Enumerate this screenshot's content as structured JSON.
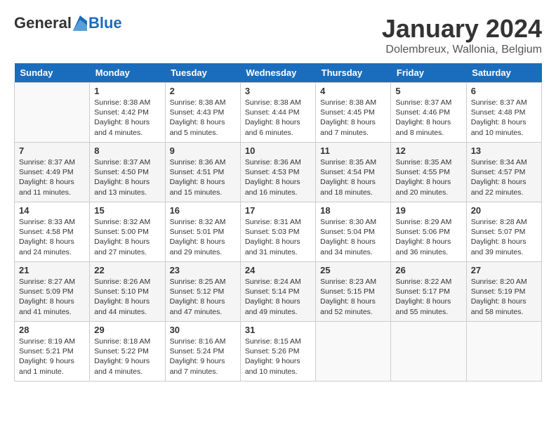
{
  "logo": {
    "general": "General",
    "blue": "Blue"
  },
  "title": "January 2024",
  "location": "Dolembreux, Wallonia, Belgium",
  "days_of_week": [
    "Sunday",
    "Monday",
    "Tuesday",
    "Wednesday",
    "Thursday",
    "Friday",
    "Saturday"
  ],
  "weeks": [
    [
      {
        "day": "",
        "sunrise": "",
        "sunset": "",
        "daylight": "",
        "empty": true
      },
      {
        "day": "1",
        "sunrise": "Sunrise: 8:38 AM",
        "sunset": "Sunset: 4:42 PM",
        "daylight": "Daylight: 8 hours and 4 minutes."
      },
      {
        "day": "2",
        "sunrise": "Sunrise: 8:38 AM",
        "sunset": "Sunset: 4:43 PM",
        "daylight": "Daylight: 8 hours and 5 minutes."
      },
      {
        "day": "3",
        "sunrise": "Sunrise: 8:38 AM",
        "sunset": "Sunset: 4:44 PM",
        "daylight": "Daylight: 8 hours and 6 minutes."
      },
      {
        "day": "4",
        "sunrise": "Sunrise: 8:38 AM",
        "sunset": "Sunset: 4:45 PM",
        "daylight": "Daylight: 8 hours and 7 minutes."
      },
      {
        "day": "5",
        "sunrise": "Sunrise: 8:37 AM",
        "sunset": "Sunset: 4:46 PM",
        "daylight": "Daylight: 8 hours and 8 minutes."
      },
      {
        "day": "6",
        "sunrise": "Sunrise: 8:37 AM",
        "sunset": "Sunset: 4:48 PM",
        "daylight": "Daylight: 8 hours and 10 minutes."
      }
    ],
    [
      {
        "day": "7",
        "sunrise": "Sunrise: 8:37 AM",
        "sunset": "Sunset: 4:49 PM",
        "daylight": "Daylight: 8 hours and 11 minutes."
      },
      {
        "day": "8",
        "sunrise": "Sunrise: 8:37 AM",
        "sunset": "Sunset: 4:50 PM",
        "daylight": "Daylight: 8 hours and 13 minutes."
      },
      {
        "day": "9",
        "sunrise": "Sunrise: 8:36 AM",
        "sunset": "Sunset: 4:51 PM",
        "daylight": "Daylight: 8 hours and 15 minutes."
      },
      {
        "day": "10",
        "sunrise": "Sunrise: 8:36 AM",
        "sunset": "Sunset: 4:53 PM",
        "daylight": "Daylight: 8 hours and 16 minutes."
      },
      {
        "day": "11",
        "sunrise": "Sunrise: 8:35 AM",
        "sunset": "Sunset: 4:54 PM",
        "daylight": "Daylight: 8 hours and 18 minutes."
      },
      {
        "day": "12",
        "sunrise": "Sunrise: 8:35 AM",
        "sunset": "Sunset: 4:55 PM",
        "daylight": "Daylight: 8 hours and 20 minutes."
      },
      {
        "day": "13",
        "sunrise": "Sunrise: 8:34 AM",
        "sunset": "Sunset: 4:57 PM",
        "daylight": "Daylight: 8 hours and 22 minutes."
      }
    ],
    [
      {
        "day": "14",
        "sunrise": "Sunrise: 8:33 AM",
        "sunset": "Sunset: 4:58 PM",
        "daylight": "Daylight: 8 hours and 24 minutes."
      },
      {
        "day": "15",
        "sunrise": "Sunrise: 8:32 AM",
        "sunset": "Sunset: 5:00 PM",
        "daylight": "Daylight: 8 hours and 27 minutes."
      },
      {
        "day": "16",
        "sunrise": "Sunrise: 8:32 AM",
        "sunset": "Sunset: 5:01 PM",
        "daylight": "Daylight: 8 hours and 29 minutes."
      },
      {
        "day": "17",
        "sunrise": "Sunrise: 8:31 AM",
        "sunset": "Sunset: 5:03 PM",
        "daylight": "Daylight: 8 hours and 31 minutes."
      },
      {
        "day": "18",
        "sunrise": "Sunrise: 8:30 AM",
        "sunset": "Sunset: 5:04 PM",
        "daylight": "Daylight: 8 hours and 34 minutes."
      },
      {
        "day": "19",
        "sunrise": "Sunrise: 8:29 AM",
        "sunset": "Sunset: 5:06 PM",
        "daylight": "Daylight: 8 hours and 36 minutes."
      },
      {
        "day": "20",
        "sunrise": "Sunrise: 8:28 AM",
        "sunset": "Sunset: 5:07 PM",
        "daylight": "Daylight: 8 hours and 39 minutes."
      }
    ],
    [
      {
        "day": "21",
        "sunrise": "Sunrise: 8:27 AM",
        "sunset": "Sunset: 5:09 PM",
        "daylight": "Daylight: 8 hours and 41 minutes."
      },
      {
        "day": "22",
        "sunrise": "Sunrise: 8:26 AM",
        "sunset": "Sunset: 5:10 PM",
        "daylight": "Daylight: 8 hours and 44 minutes."
      },
      {
        "day": "23",
        "sunrise": "Sunrise: 8:25 AM",
        "sunset": "Sunset: 5:12 PM",
        "daylight": "Daylight: 8 hours and 47 minutes."
      },
      {
        "day": "24",
        "sunrise": "Sunrise: 8:24 AM",
        "sunset": "Sunset: 5:14 PM",
        "daylight": "Daylight: 8 hours and 49 minutes."
      },
      {
        "day": "25",
        "sunrise": "Sunrise: 8:23 AM",
        "sunset": "Sunset: 5:15 PM",
        "daylight": "Daylight: 8 hours and 52 minutes."
      },
      {
        "day": "26",
        "sunrise": "Sunrise: 8:22 AM",
        "sunset": "Sunset: 5:17 PM",
        "daylight": "Daylight: 8 hours and 55 minutes."
      },
      {
        "day": "27",
        "sunrise": "Sunrise: 8:20 AM",
        "sunset": "Sunset: 5:19 PM",
        "daylight": "Daylight: 8 hours and 58 minutes."
      }
    ],
    [
      {
        "day": "28",
        "sunrise": "Sunrise: 8:19 AM",
        "sunset": "Sunset: 5:21 PM",
        "daylight": "Daylight: 9 hours and 1 minute."
      },
      {
        "day": "29",
        "sunrise": "Sunrise: 8:18 AM",
        "sunset": "Sunset: 5:22 PM",
        "daylight": "Daylight: 9 hours and 4 minutes."
      },
      {
        "day": "30",
        "sunrise": "Sunrise: 8:16 AM",
        "sunset": "Sunset: 5:24 PM",
        "daylight": "Daylight: 9 hours and 7 minutes."
      },
      {
        "day": "31",
        "sunrise": "Sunrise: 8:15 AM",
        "sunset": "Sunset: 5:26 PM",
        "daylight": "Daylight: 9 hours and 10 minutes."
      },
      {
        "day": "",
        "sunrise": "",
        "sunset": "",
        "daylight": "",
        "empty": true
      },
      {
        "day": "",
        "sunrise": "",
        "sunset": "",
        "daylight": "",
        "empty": true
      },
      {
        "day": "",
        "sunrise": "",
        "sunset": "",
        "daylight": "",
        "empty": true
      }
    ]
  ]
}
